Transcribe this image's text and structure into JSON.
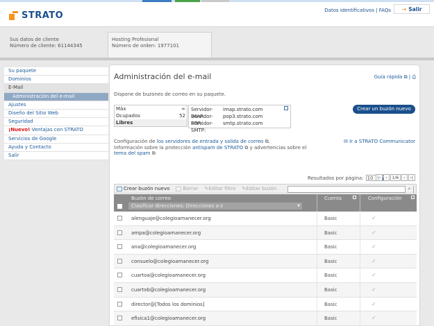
{
  "header": {
    "logo_text": "STRATO",
    "links_text": "Datos identificativos | FAQs",
    "logout_label": "Salir"
  },
  "customer": {
    "line1": "Sus datos de cliente",
    "line2": "Número de cliente: 61144345",
    "product_line1": "Hosting Profesional",
    "product_line2": "Número de orden: 1977101"
  },
  "sidebar": {
    "items": [
      {
        "label": "Su paquete"
      },
      {
        "label": "Dominios"
      },
      {
        "label": "E-Mail"
      },
      {
        "label": "Administración del e-mail"
      },
      {
        "label": "Ajustes"
      },
      {
        "label": "Diseño del Sitio Web"
      },
      {
        "label": "Seguridad"
      },
      {
        "label_new": "¡Nuevo!",
        "label": " Ventajas con STRATO"
      },
      {
        "label": "Servicios de Google"
      },
      {
        "label": "Ayuda y Contacto"
      },
      {
        "label": "Salir"
      }
    ]
  },
  "main": {
    "title": "Administración del e-mail",
    "quick_guide": "Guía rápida",
    "subtitle": "Dispone de buzones de correo en su paquete.",
    "quota": {
      "max_label": "Máx",
      "max_value": "∞",
      "used_label": "Ocupados",
      "used_value": "52",
      "free_label": "Libres",
      "free_value": ""
    },
    "servers": [
      {
        "key": "Servidor-IMAP:",
        "value": "imap.strato.com"
      },
      {
        "key": "Servidor-POP:",
        "value": "pop3.strato.com"
      },
      {
        "key": "Servidor-SMTP:",
        "value": "smtp.strato.com"
      }
    ],
    "create_button": "Crear un buzón nuevo",
    "config_line1_a": "Configuración de ",
    "config_line1_link": "los servidores de entrada y salida de correo",
    "config_line2_a": "Información sobre la protección ",
    "config_line2_link": "antispam de STRATO",
    "config_line2_b": " y advertencias sobre el",
    "config_line3_link": "tema del spam",
    "communicator_link": "Ir a STRATO Communicator",
    "per_page_label": "Resultados por página:",
    "per_page_value": "10",
    "pager": {
      "first": "|‹",
      "prev": "‹",
      "page": "1/6",
      "next": "›",
      "last": "›|"
    }
  },
  "toolbar": {
    "create": "Crear buzón nuevo",
    "delete": "Borrar",
    "edit_filter": "Editar filtro",
    "edit_mailbox": "Editar buzón",
    "search_placeholder": ""
  },
  "table": {
    "col_mailbox": "Buzón de correo",
    "sort_label": "Clasificar direcciones: Direcciones a-z",
    "col_account": "Cuenta",
    "col_config": "Configuración",
    "rows": [
      {
        "email": "alenguaje@colegioamanecer.org",
        "account": "Basic"
      },
      {
        "email": "ampa@colegioamanecer.org",
        "account": "Basic"
      },
      {
        "email": "ana@colegioamanecer.org",
        "account": "Basic"
      },
      {
        "email": "consuelo@colegioamanecer.org",
        "account": "Basic"
      },
      {
        "email": "cuartoa@colegioamanecer.org",
        "account": "Basic"
      },
      {
        "email": "cuartob@colegioamanecer.org",
        "account": "Basic"
      },
      {
        "email": "director@[Todos los dominios]",
        "account": "Basic"
      },
      {
        "email": "efisica1@colegioamanecer.org",
        "account": "Basic"
      }
    ]
  },
  "colors": {
    "brand_blue": "#1b4f8c",
    "brand_orange": "#f7931e",
    "active_nav": "#8fa8c4",
    "header_gray": "#8a8a8a"
  }
}
